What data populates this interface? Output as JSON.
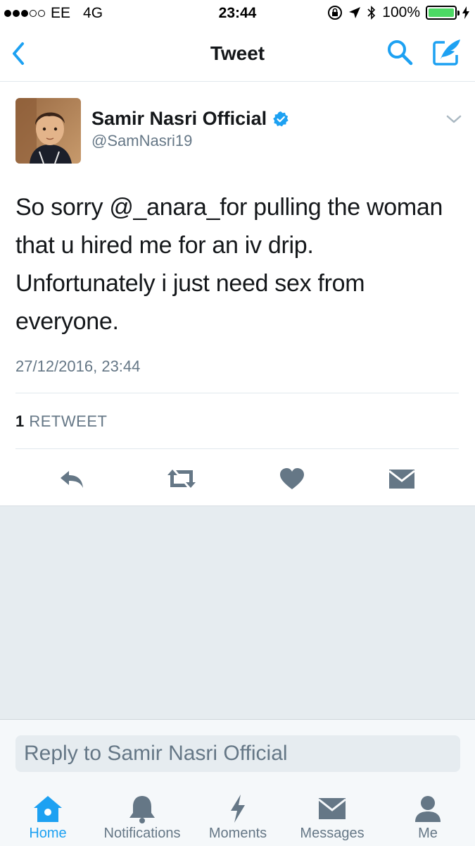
{
  "status_bar": {
    "carrier": "EE",
    "network": "4G",
    "time": "23:44",
    "battery": "100%",
    "signal_bars_filled": 3,
    "signal_bars_total": 5,
    "battery_level": 1.0
  },
  "nav": {
    "title": "Tweet"
  },
  "tweet": {
    "author_name": "Samir Nasri Official",
    "author_handle": "@SamNasri19",
    "verified": true,
    "text": "So sorry @_anara_for pulling the woman that u hired me for an iv drip. Unfortunately i just need sex from everyone.",
    "timestamp": "27/12/2016, 23:44",
    "retweet_count": "1",
    "retweet_label": "RETWEET"
  },
  "reply": {
    "placeholder": "Reply to Samir Nasri Official"
  },
  "tabs": [
    {
      "label": "Home",
      "icon": "home-icon",
      "active": true
    },
    {
      "label": "Notifications",
      "icon": "bell-icon",
      "active": false
    },
    {
      "label": "Moments",
      "icon": "lightning-icon",
      "active": false
    },
    {
      "label": "Messages",
      "icon": "envelope-icon",
      "active": false
    },
    {
      "label": "Me",
      "icon": "person-icon",
      "active": false
    }
  ],
  "colors": {
    "accent": "#1da1f2",
    "text": "#14171a",
    "secondary": "#657786",
    "icon_grey": "#657786",
    "background_grey": "#e6ecf0"
  }
}
